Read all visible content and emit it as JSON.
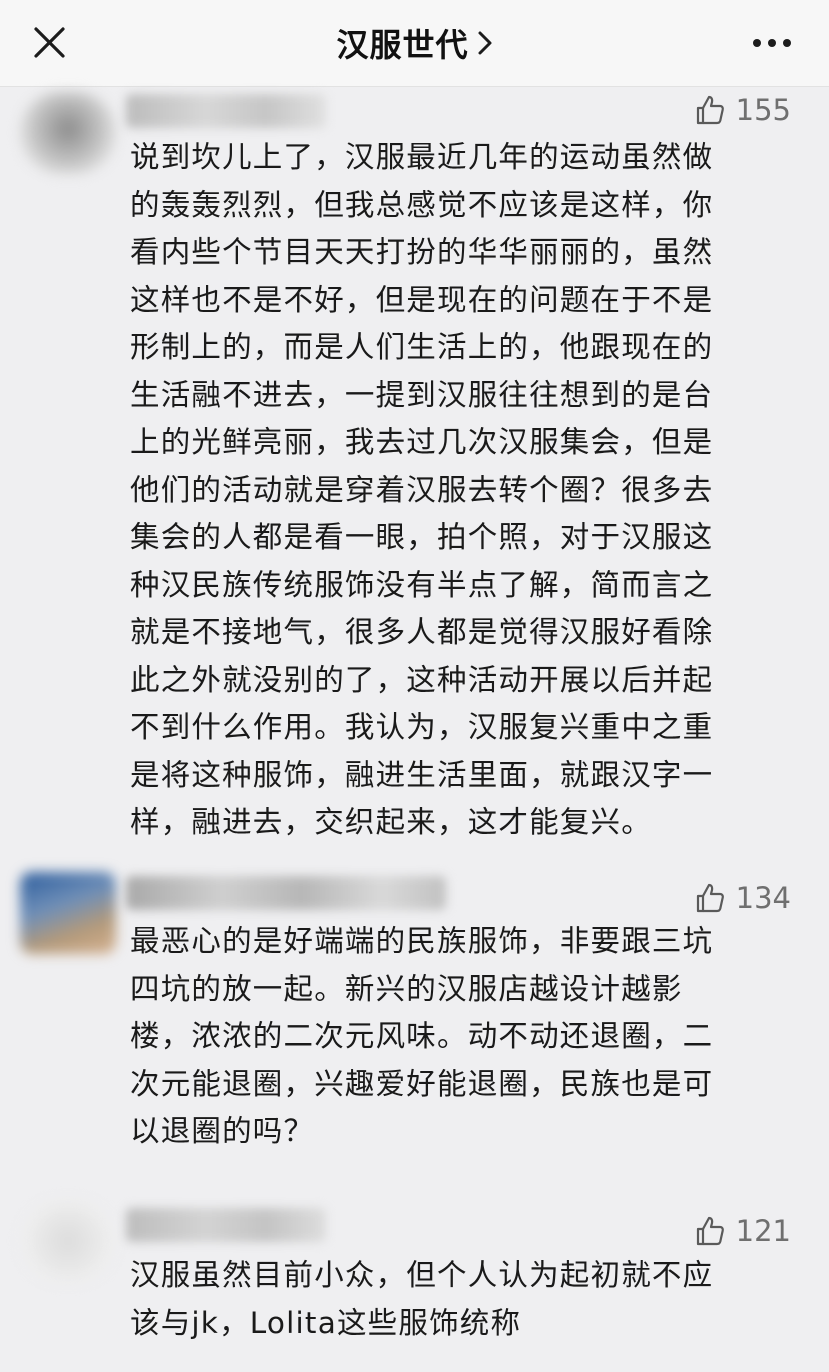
{
  "header": {
    "title": "汉服世代"
  },
  "comments": [
    {
      "likes": "155",
      "text": "说到坎儿上了，汉服最近几年的运动虽然做\n的轰轰烈烈，但我总感觉不应该是这样，你\n看内些个节目天天打扮的华华丽丽的，虽然\n这样也不是不好，但是现在的问题在于不是\n形制上的，而是人们生活上的，他跟现在的\n生活融不进去，一提到汉服往往想到的是台\n上的光鲜亮丽，我去过几次汉服集会，但是\n他们的活动就是穿着汉服去转个圈？很多去\n集会的人都是看一眼，拍个照，对于汉服这\n种汉民族传统服饰没有半点了解，简而言之\n就是不接地气，很多人都是觉得汉服好看除\n此之外就没别的了，这种活动开展以后并起\n不到什么作用。我认为，汉服复兴重中之重\n是将这种服饰，融进生活里面，就跟汉字一\n样，融进去，交织起来，这才能复兴。"
    },
    {
      "likes": "134",
      "text": "最恶心的是好端端的民族服饰，非要跟三坑\n四坑的放一起。新兴的汉服店越设计越影\n楼，浓浓的二次元风味。动不动还退圈，二\n次元能退圈，兴趣爱好能退圈，民族也是可\n以退圈的吗？"
    },
    {
      "likes": "121",
      "text": "汉服虽然目前小众，但个人认为起初就不应\n该与jk，Lolita这些服饰统称"
    }
  ],
  "icons": {
    "close": "close-icon",
    "chevron": "chevron-right-icon",
    "more": "more-dots-icon",
    "like": "thumbs-up-icon"
  },
  "colors": {
    "background": "#efeff1",
    "header_bg": "#f7f7f7",
    "text": "#1a1a1a",
    "muted": "#6f6f6f"
  }
}
